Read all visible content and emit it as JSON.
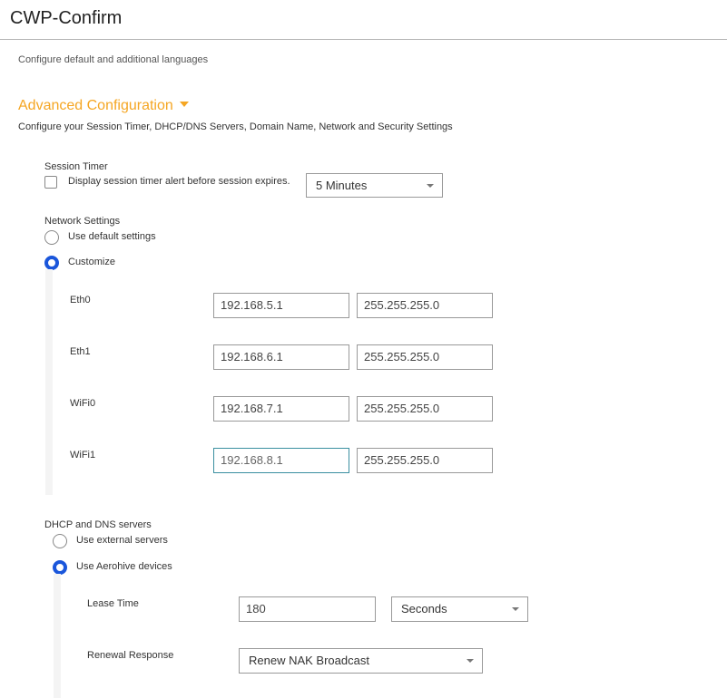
{
  "app": {
    "title": "CWP-Confirm"
  },
  "languages": {
    "description": "Configure default and additional languages"
  },
  "advanced": {
    "title": "Advanced Configuration",
    "description": "Configure your Session Timer, DHCP/DNS Servers, Domain Name, Network and Security Settings"
  },
  "session_timer": {
    "label": "Session Timer",
    "checkbox_label": "Display session timer alert before session expires.",
    "checked": false,
    "select_value": "5 Minutes"
  },
  "network": {
    "label": "Network Settings",
    "option_default": "Use default settings",
    "option_customize": "Customize",
    "selected": "Customize",
    "interfaces": [
      {
        "name": "Eth0",
        "ip": "192.168.5.1",
        "mask": "255.255.255.0"
      },
      {
        "name": "Eth1",
        "ip": "192.168.6.1",
        "mask": "255.255.255.0"
      },
      {
        "name": "WiFi0",
        "ip": "192.168.7.1",
        "mask": "255.255.255.0"
      },
      {
        "name": "WiFi1",
        "ip": "192.168.8.1",
        "mask": "255.255.255.0"
      }
    ]
  },
  "dhcp": {
    "label": "DHCP and DNS servers",
    "option_external": "Use external servers",
    "option_aerohive": "Use Aerohive devices",
    "selected": "Use Aerohive devices",
    "lease_time_label": "Lease Time",
    "lease_time_value": "180",
    "lease_unit": "Seconds",
    "renewal_label": "Renewal Response",
    "renewal_value": "Renew NAK Broadcast"
  },
  "colors": {
    "accent": "#f5a623",
    "radio_selected": "#1a56db",
    "focus_border": "#3a8fa0"
  }
}
